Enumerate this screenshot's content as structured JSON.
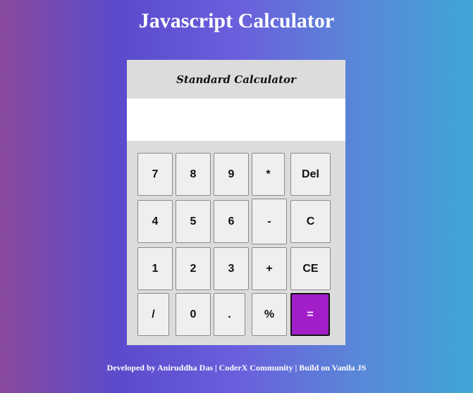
{
  "page": {
    "title": "Javascript Calculator"
  },
  "calculator": {
    "header": "Standard Calculator",
    "display_value": "",
    "keys": {
      "k7": "7",
      "k8": "8",
      "k9": "9",
      "mul": "*",
      "del": "Del",
      "k4": "4",
      "k5": "5",
      "k6": "6",
      "sub": "-",
      "clear": "C",
      "k1": "1",
      "k2": "2",
      "k3": "3",
      "add": "+",
      "ce": "CE",
      "div": "/",
      "k0": "0",
      "dot": ".",
      "pct": "%",
      "eq": "="
    },
    "equals_color": "#a11ec8"
  },
  "footer": {
    "text": "Developed by Aniruddha Das | CoderX Community | Build on Vanila JS"
  }
}
